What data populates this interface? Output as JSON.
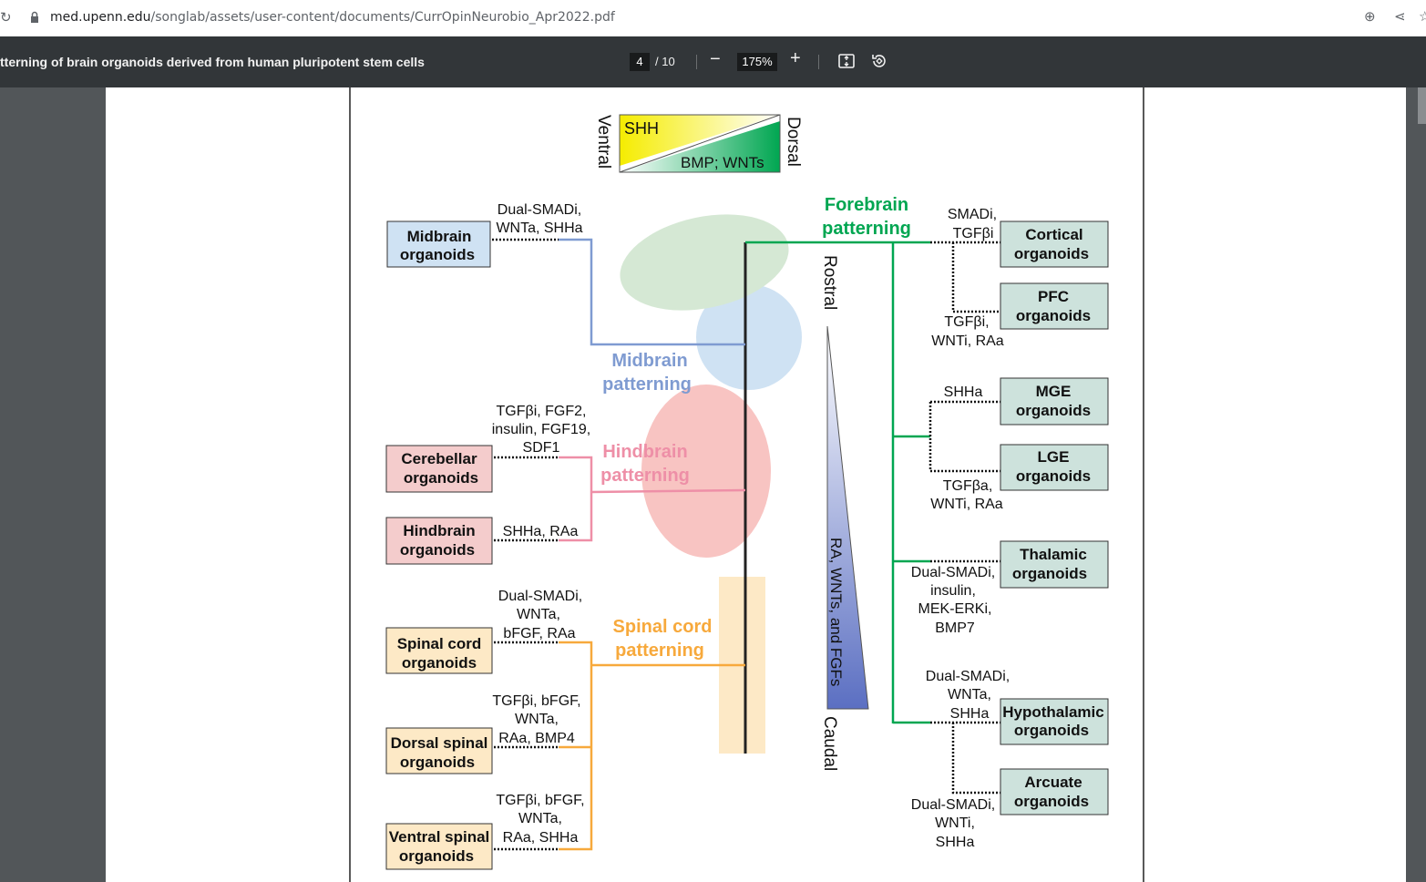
{
  "browser": {
    "url_host": "med.upenn.edu",
    "url_path": "/songlab/assets/user-content/documents/CurrOpinNeurobio_Apr2022.pdf"
  },
  "viewer": {
    "doc_title": "tterning of brain organoids derived from human pluripotent stem cells",
    "current_page": "4",
    "total_pages": "/ 10",
    "zoom": "175%",
    "zoom_out": "−",
    "zoom_in": "+"
  },
  "figure": {
    "gradient_top": {
      "left_label": "Ventral",
      "right_label": "Dorsal",
      "shh": "SHH",
      "bmp_wnt": "BMP; WNTs"
    },
    "axis": {
      "rostral": "Rostral",
      "caudal": "Caudal",
      "gradient": "RA, WNTs, and FGFs"
    },
    "patterning": {
      "forebrain": [
        "Forebrain",
        "patterning"
      ],
      "midbrain": [
        "Midbrain",
        "patterning"
      ],
      "hindbrain": [
        "Hindbrain",
        "patterning"
      ],
      "spinal": [
        "Spinal cord",
        "patterning"
      ]
    },
    "colors": {
      "forebrain": "#00a651",
      "midbrain": "#7f9bd1",
      "hindbrain": "#ee8fa7",
      "spinal": "#f7a93c",
      "forebrain_fill": "#d5e8d4",
      "midbrain_fill": "#cfe2f3",
      "hindbrain_fill": "#f8c4c2",
      "spinal_fill": "#fde9c6",
      "box_green": "#cde2dc",
      "box_blue": "#cfe2f3",
      "box_pink": "#f4cccc",
      "box_orange": "#fde9c6"
    },
    "left_organoids": [
      {
        "name": [
          "Midbrain",
          "organoids"
        ],
        "factors": [
          "Dual-SMADi,",
          "WNTa, SHHa"
        ]
      },
      {
        "name": [
          "Cerebellar",
          "organoids"
        ],
        "factors": [
          "TGFβi, FGF2,",
          "insulin, FGF19,",
          "SDF1"
        ]
      },
      {
        "name": [
          "Hindbrain",
          "organoids"
        ],
        "factors": [
          "SHHa, RAa"
        ]
      },
      {
        "name": [
          "Spinal cord",
          "organoids"
        ],
        "factors": [
          "Dual-SMADi,",
          "WNTa,",
          "bFGF, RAa"
        ]
      },
      {
        "name": [
          "Dorsal spinal",
          "organoids"
        ],
        "factors": [
          "TGFβi, bFGF,",
          "WNTa,",
          "RAa, BMP4"
        ]
      },
      {
        "name": [
          "Ventral spinal",
          "organoids"
        ],
        "factors": [
          "TGFβi, bFGF,",
          "WNTa,",
          "RAa, SHHa"
        ]
      }
    ],
    "right_organoids": [
      {
        "name": [
          "Cortical",
          "organoids"
        ],
        "factors": [
          "SMADi,",
          "TGFβi"
        ]
      },
      {
        "name": [
          "PFC",
          "organoids"
        ],
        "factors": [
          "TGFβi,",
          "WNTi, RAa"
        ]
      },
      {
        "name": [
          "MGE",
          "organoids"
        ],
        "factors": [
          "SHHa"
        ]
      },
      {
        "name": [
          "LGE",
          "organoids"
        ],
        "factors": [
          "TGFβa,",
          "WNTi, RAa"
        ]
      },
      {
        "name": [
          "Thalamic",
          "organoids"
        ],
        "factors": [
          "Dual-SMADi,",
          "insulin,",
          "MEK-ERKi,",
          "BMP7"
        ]
      },
      {
        "name": [
          "Hypothalamic",
          "organoids"
        ],
        "factors": [
          "Dual-SMADi,",
          "WNTa,",
          "SHHa"
        ]
      },
      {
        "name": [
          "Arcuate",
          "organoids"
        ],
        "factors": [
          "Dual-SMADi,",
          "WNTi,",
          "SHHa"
        ]
      }
    ]
  }
}
